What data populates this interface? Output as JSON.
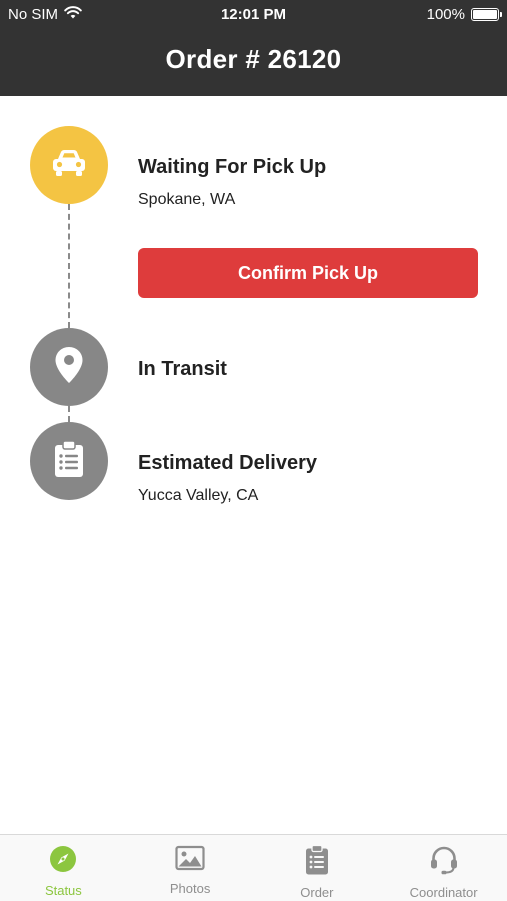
{
  "status_bar": {
    "carrier": "No SIM",
    "time": "12:01 PM",
    "battery": "100%"
  },
  "header": {
    "title": "Order # 26120"
  },
  "timeline": {
    "steps": [
      {
        "title": "Waiting For Pick Up",
        "subtitle": "Spokane, WA",
        "icon": "car-icon",
        "state": "active"
      },
      {
        "title": "In Transit",
        "subtitle": "",
        "icon": "location-pin-icon",
        "state": "inactive"
      },
      {
        "title": "Estimated Delivery",
        "subtitle": "Yucca Valley, CA",
        "icon": "clipboard-icon",
        "state": "inactive"
      }
    ],
    "confirm_button_label": "Confirm Pick Up"
  },
  "tabbar": {
    "tabs": [
      {
        "label": "Status",
        "icon": "compass-icon",
        "active": true
      },
      {
        "label": "Photos",
        "icon": "image-icon",
        "active": false
      },
      {
        "label": "Order",
        "icon": "clipboard-list-icon",
        "active": false
      },
      {
        "label": "Coordinator",
        "icon": "headset-icon",
        "active": false
      }
    ]
  },
  "colors": {
    "header_bg": "#333333",
    "active_step": "#f4c443",
    "inactive_step": "#878787",
    "confirm_button": "#de3c3c",
    "active_tab": "#8cc63f",
    "inactive_tab": "#8e8e8e"
  }
}
